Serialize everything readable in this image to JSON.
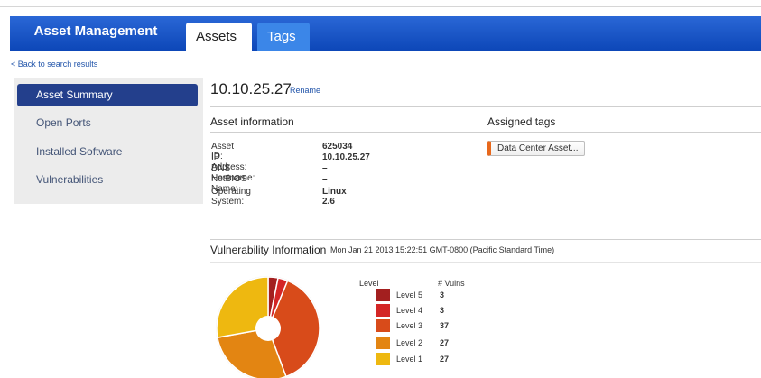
{
  "header": {
    "brand": "Asset Management",
    "tabs": [
      {
        "label": "Assets",
        "active": true
      },
      {
        "label": "Tags",
        "active": false
      }
    ]
  },
  "back_link": "< Back to search results",
  "sidebar": {
    "items": [
      {
        "label": "Asset Summary",
        "active": true
      },
      {
        "label": "Open Ports",
        "active": false
      },
      {
        "label": "Installed Software",
        "active": false
      },
      {
        "label": "Vulnerabilities",
        "active": false
      }
    ]
  },
  "asset": {
    "title": "10.10.25.27",
    "rename_label": "Rename"
  },
  "asset_info": {
    "heading": "Asset information",
    "rows": [
      {
        "label": "Asset ID:",
        "value": "625034"
      },
      {
        "label": "IP Address:",
        "value": "10.10.25.27"
      },
      {
        "label": "DNS Hostname:",
        "value": "–"
      },
      {
        "label": "NetBIOS Name:",
        "value": "–"
      },
      {
        "label": "Operating System:",
        "value": "Linux 2.6"
      }
    ]
  },
  "assigned_tags": {
    "heading": "Assigned tags",
    "tags": [
      "Data Center Asset..."
    ]
  },
  "vulnerability": {
    "heading": "Vulnerability Information",
    "timestamp": "Mon Jan 21 2013 15:22:51 GMT-0800 (Pacific Standard Time)",
    "legend_level_header": "Level",
    "legend_count_header": "# Vulns",
    "levels": [
      {
        "label": "Level 5",
        "count": "3",
        "color": "#a31f1f"
      },
      {
        "label": "Level 4",
        "count": "3",
        "color": "#d42626"
      },
      {
        "label": "Level 3",
        "count": "37",
        "color": "#d84b1a"
      },
      {
        "label": "Level 2",
        "count": "27",
        "color": "#e38512"
      },
      {
        "label": "Level 1",
        "count": "27",
        "color": "#eeb810"
      }
    ]
  },
  "chart_data": {
    "type": "pie",
    "categories": [
      "Level 5",
      "Level 4",
      "Level 3",
      "Level 2",
      "Level 1"
    ],
    "values": [
      3,
      3,
      37,
      27,
      27
    ],
    "colors": [
      "#a31f1f",
      "#d42626",
      "#d84b1a",
      "#e38512",
      "#eeb810"
    ]
  }
}
